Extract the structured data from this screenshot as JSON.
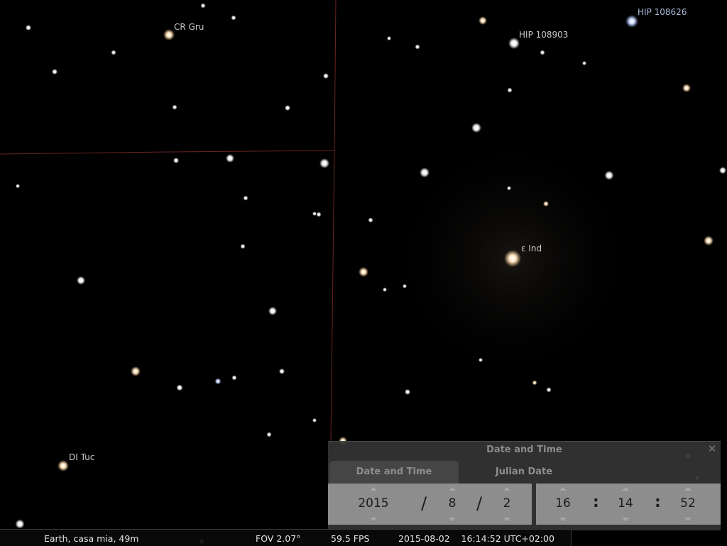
{
  "sky": {
    "labels": {
      "cr_gru": "CR Gru",
      "hip_108903": "HIP 108903",
      "hip_108626": "HIP 108626",
      "eps_ind": "ε Ind",
      "di_tuc": "DI Tuc"
    },
    "colors": {
      "constellation_boundary": "#6b2424",
      "label": "#c9c9c9",
      "label_blue": "#a9b9d9"
    }
  },
  "dialog": {
    "title": "Date and Time",
    "close_icon": "close-icon",
    "tabs": [
      {
        "label": "Date and Time",
        "active": true
      },
      {
        "label": "Julian Date",
        "active": false
      }
    ],
    "date": {
      "year": "2015",
      "month": "8",
      "day": "2",
      "separator": "/"
    },
    "time": {
      "hour": "16",
      "minute": "14",
      "second": "52",
      "separator": ":"
    }
  },
  "status": {
    "location": "Earth, casa mia, 49m",
    "fov": "FOV 2.07°",
    "fps": "59.5 FPS",
    "datetime": "2015-08-02    16:14:52 UTC+02:00"
  }
}
